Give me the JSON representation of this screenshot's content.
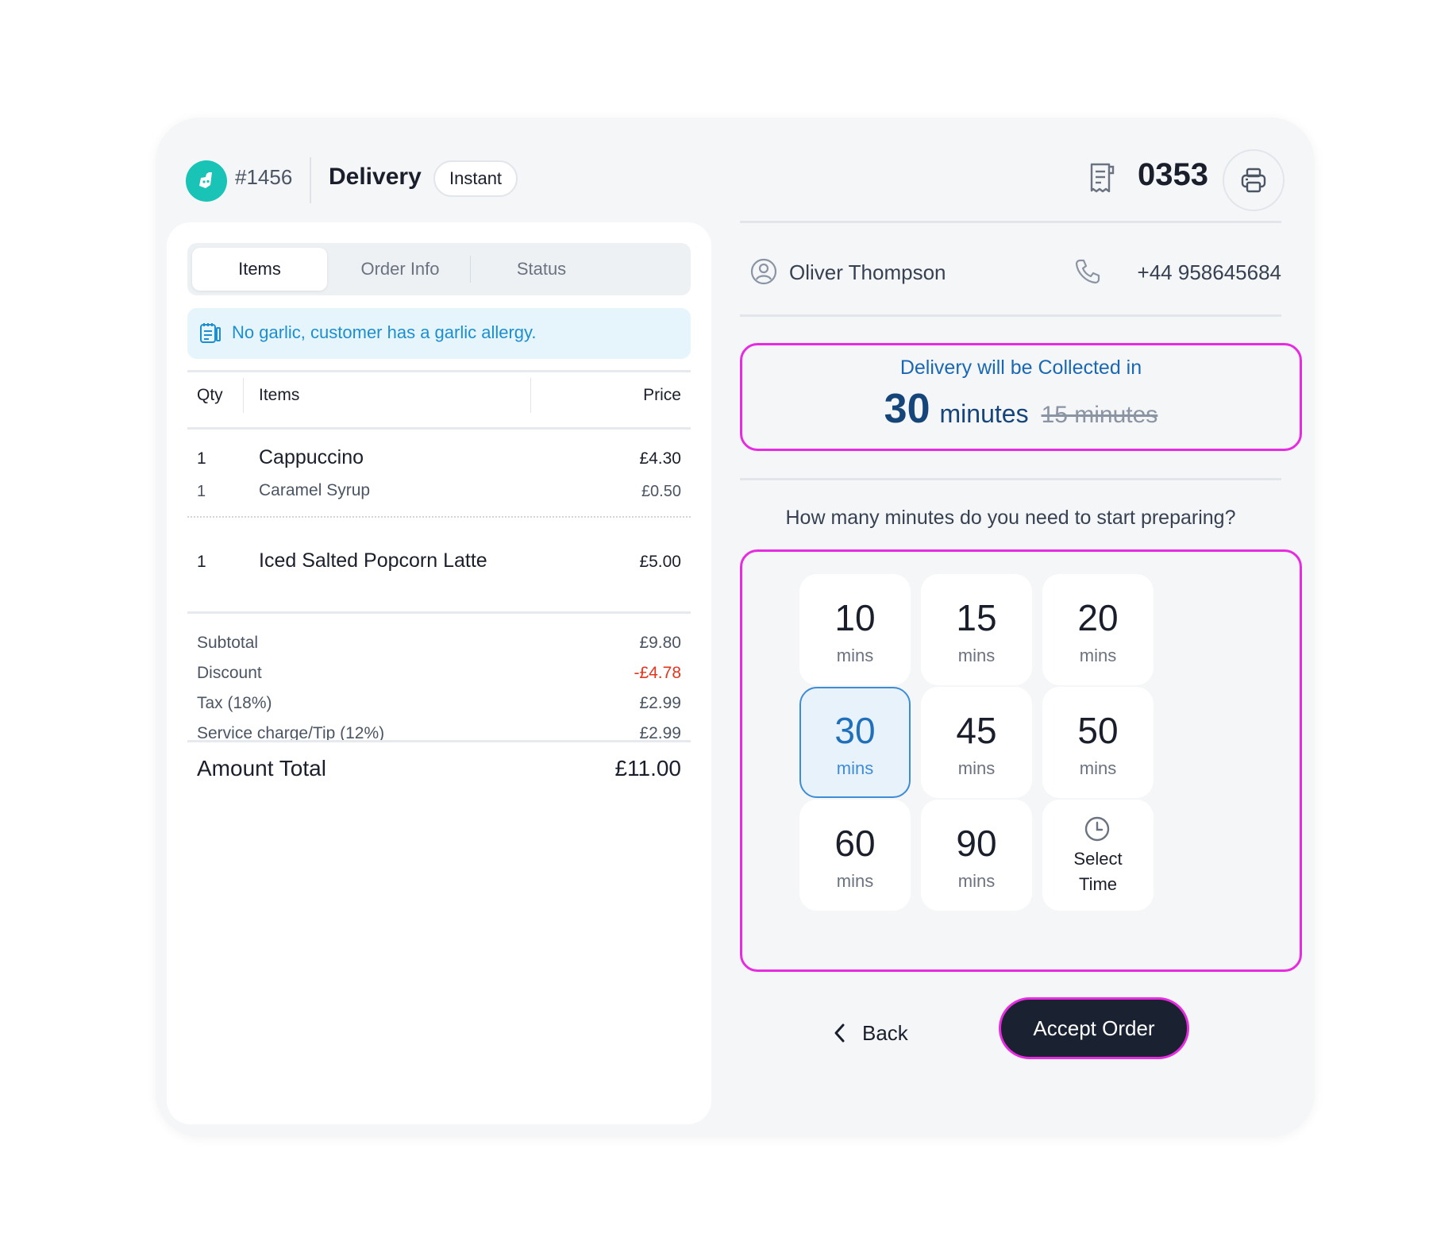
{
  "header": {
    "order_number": "#1456",
    "order_type": "Delivery",
    "badge": "Instant",
    "ticket_number": "0353"
  },
  "tabs": [
    "Items",
    "Order Info",
    "Status"
  ],
  "active_tab": "Items",
  "note": "No garlic, customer has a garlic allergy.",
  "table": {
    "headers": {
      "qty": "Qty",
      "items": "Items",
      "price": "Price"
    },
    "rows": [
      {
        "qty": "1",
        "name": "Cappuccino",
        "price": "£4.30",
        "modifier": {
          "qty": "1",
          "name": "Caramel Syrup",
          "price": "£0.50"
        }
      },
      {
        "qty": "1",
        "name": "Iced Salted Popcorn Latte",
        "price": "£5.00"
      }
    ]
  },
  "summary": [
    {
      "label": "Subtotal",
      "value": "£9.80"
    },
    {
      "label": "Discount",
      "value": "-£4.78"
    },
    {
      "label": "Tax (18%)",
      "value": "£2.99"
    },
    {
      "label": "Service charge/Tip (12%)",
      "value": "£2.99"
    }
  ],
  "total": {
    "label": "Amount Total",
    "value": "£11.00"
  },
  "customer": {
    "name": "Oliver Thompson",
    "phone": "+44 958645684"
  },
  "collection": {
    "label": "Delivery will be Collected in",
    "minutes": "30",
    "unit": "minutes",
    "previous": "15 minutes"
  },
  "question": "How many minutes do you need to start preparing?",
  "options": [
    {
      "value": "10",
      "unit": "mins"
    },
    {
      "value": "15",
      "unit": "mins"
    },
    {
      "value": "20",
      "unit": "mins"
    },
    {
      "value": "30",
      "unit": "mins",
      "selected": true
    },
    {
      "value": "45",
      "unit": "mins"
    },
    {
      "value": "50",
      "unit": "mins"
    },
    {
      "value": "60",
      "unit": "mins"
    },
    {
      "value": "90",
      "unit": "mins"
    }
  ],
  "select_time": {
    "line1": "Select",
    "line2": "Time"
  },
  "actions": {
    "back": "Back",
    "accept": "Accept Order"
  },
  "colors": {
    "brand": "#19c3b6",
    "accent": "#1f6fba",
    "highlight": "#e72be0",
    "discount": "#e2361f",
    "primary_button": "#1a2232"
  },
  "icons": {
    "logo": "deliveroo-logo-icon",
    "ticket": "receipt-icon",
    "print": "printer-icon",
    "note": "note-icon",
    "customer": "user-icon",
    "phone": "phone-icon",
    "clock": "clock-icon",
    "back": "chevron-left-icon"
  }
}
